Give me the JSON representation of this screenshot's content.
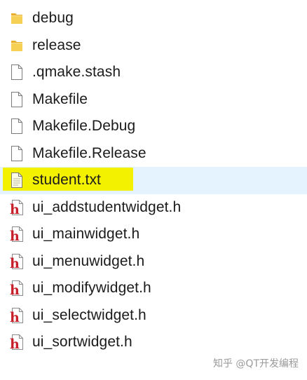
{
  "files": [
    {
      "name": "debug",
      "type": "folder",
      "icon": "folder-icon"
    },
    {
      "name": "release",
      "type": "folder",
      "icon": "folder-icon"
    },
    {
      "name": ".qmake.stash",
      "type": "file",
      "icon": "file-icon"
    },
    {
      "name": "Makefile",
      "type": "file",
      "icon": "file-icon"
    },
    {
      "name": "Makefile.Debug",
      "type": "file",
      "icon": "file-icon"
    },
    {
      "name": "Makefile.Release",
      "type": "file",
      "icon": "file-icon"
    },
    {
      "name": "student.txt",
      "type": "text",
      "icon": "text-file-icon",
      "selected": true
    },
    {
      "name": "ui_addstudentwidget.h",
      "type": "header",
      "icon": "header-file-icon"
    },
    {
      "name": "ui_mainwidget.h",
      "type": "header",
      "icon": "header-file-icon"
    },
    {
      "name": "ui_menuwidget.h",
      "type": "header",
      "icon": "header-file-icon"
    },
    {
      "name": "ui_modifywidget.h",
      "type": "header",
      "icon": "header-file-icon"
    },
    {
      "name": "ui_selectwidget.h",
      "type": "header",
      "icon": "header-file-icon"
    },
    {
      "name": "ui_sortwidget.h",
      "type": "header",
      "icon": "header-file-icon"
    }
  ],
  "colors": {
    "selection_background": "#e5f3ff",
    "highlighter": "#f3f000",
    "folder": "#f0c040",
    "header_icon_red": "#c8202a"
  },
  "watermark": "知乎 @QT开发编程"
}
